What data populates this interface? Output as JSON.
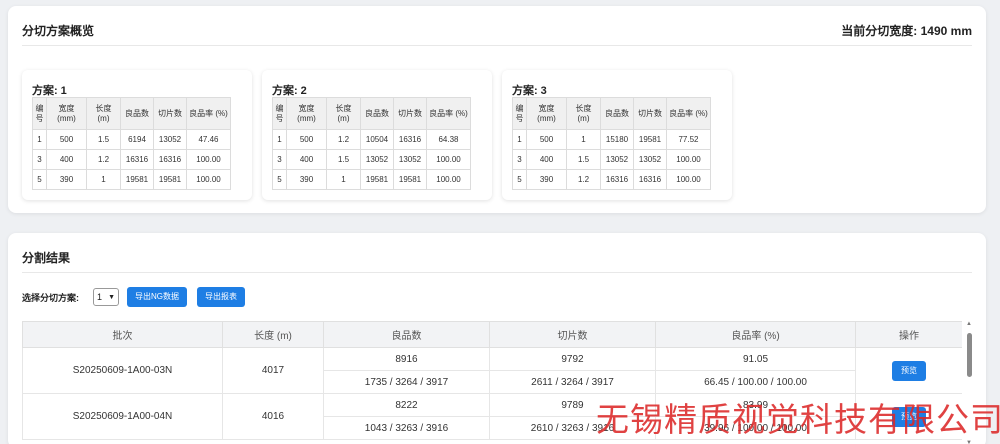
{
  "overview": {
    "title": "分切方案概览",
    "current_width_label": "当前分切宽度: 1490 mm",
    "column_headers": [
      "编号",
      "宽度 (mm)",
      "长度 (m)",
      "良品数",
      "切片数",
      "良品率 (%)"
    ],
    "plans": [
      {
        "label": "方案:",
        "number": "1",
        "rows": [
          [
            "1",
            "500",
            "1.5",
            "6194",
            "13052",
            "47.46"
          ],
          [
            "3",
            "400",
            "1.2",
            "16316",
            "16316",
            "100.00"
          ],
          [
            "5",
            "390",
            "1",
            "19581",
            "19581",
            "100.00"
          ]
        ]
      },
      {
        "label": "方案:",
        "number": "2",
        "rows": [
          [
            "1",
            "500",
            "1.2",
            "10504",
            "16316",
            "64.38"
          ],
          [
            "3",
            "400",
            "1.5",
            "13052",
            "13052",
            "100.00"
          ],
          [
            "5",
            "390",
            "1",
            "19581",
            "19581",
            "100.00"
          ]
        ]
      },
      {
        "label": "方案:",
        "number": "3",
        "rows": [
          [
            "1",
            "500",
            "1",
            "15180",
            "19581",
            "77.52"
          ],
          [
            "3",
            "400",
            "1.5",
            "13052",
            "13052",
            "100.00"
          ],
          [
            "5",
            "390",
            "1.2",
            "16316",
            "16316",
            "100.00"
          ]
        ]
      }
    ]
  },
  "results": {
    "title": "分割结果",
    "select_label": "选择分切方案:",
    "select_value": "1",
    "export_ng_label": "导出NG数据",
    "export_report_label": "导出报表",
    "headers": [
      "批次",
      "长度 (m)",
      "良品数",
      "切片数",
      "良品率 (%)",
      "操作"
    ],
    "rows": [
      {
        "batch": "S20250609-1A00-03N",
        "length": "4017",
        "good_total": "8916",
        "slices_total": "9792",
        "rate_total": "91.05",
        "good_split": "1735 / 3264 / 3917",
        "slices_split": "2611 / 3264 / 3917",
        "rate_split": "66.45 / 100.00 / 100.00",
        "action": "预览"
      },
      {
        "batch": "S20250609-1A00-04N",
        "length": "4016",
        "good_total": "8222",
        "slices_total": "9789",
        "rate_total": "83.99",
        "good_split": "1043 / 3263 / 3916",
        "slices_split": "2610 / 3263 / 3916",
        "rate_split": "39.96 / 100.00 / 100.00",
        "action": "预览"
      }
    ]
  },
  "watermark": "无锡精质视觉科技有限公司",
  "colors": {
    "primary": "#1e7ee4",
    "watermark": "#dc2828",
    "background": "#eef0f3"
  },
  "icons": {
    "select_chevron": "chevron-down-icon",
    "scroll_up": "scroll-up-icon",
    "scroll_down": "scroll-down-icon"
  }
}
